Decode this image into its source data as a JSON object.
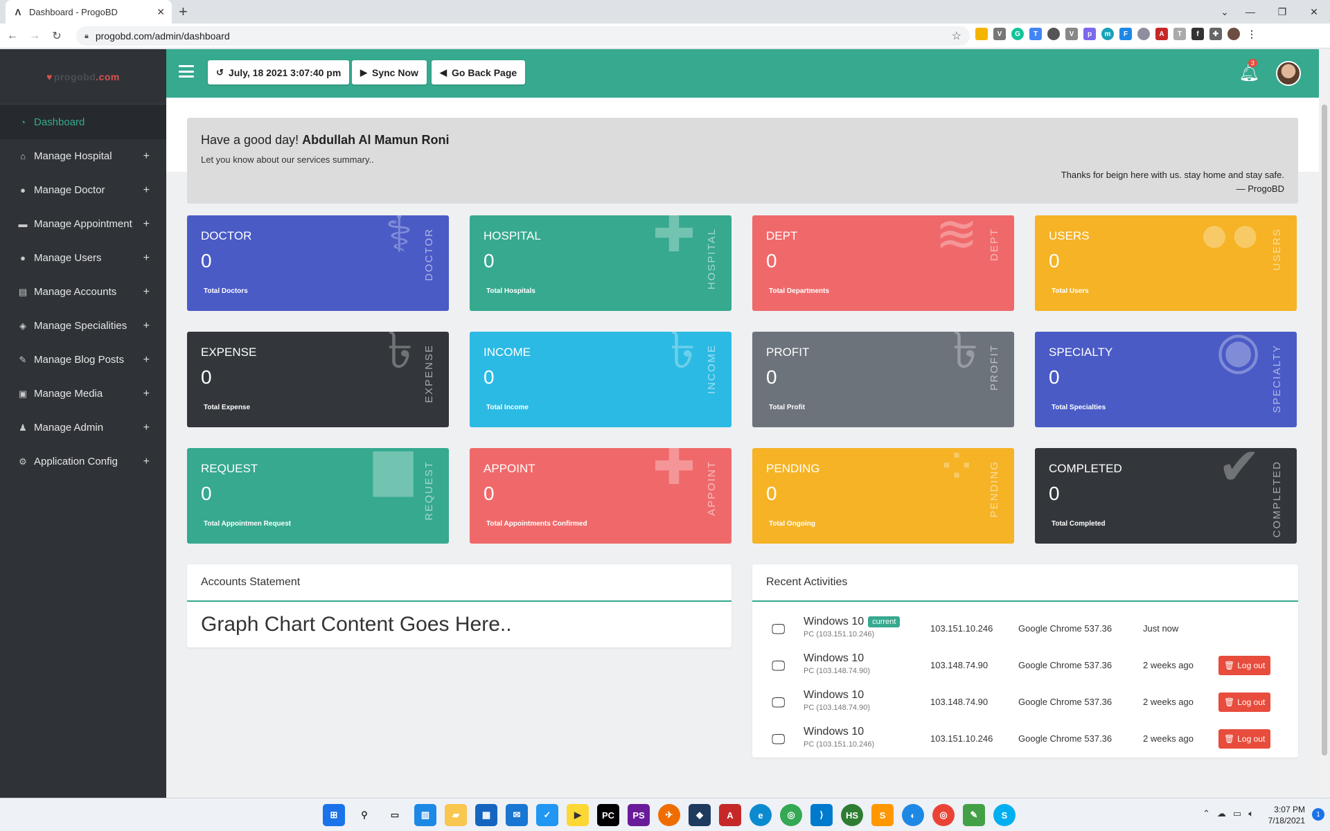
{
  "browser": {
    "tab_title": "Dashboard - ProgoBD",
    "tab_close": "✕",
    "new_tab": "+",
    "url": "progobd.com/admin/dashboard",
    "win_min": "—",
    "win_restore": "❐",
    "win_close": "✕"
  },
  "brand": {
    "logo_text": ".com"
  },
  "sidebar": {
    "items": [
      {
        "label": "Dashboard",
        "icon": "dashboard-icon",
        "active": true
      },
      {
        "label": "Manage Hospital",
        "icon": "hospital-icon"
      },
      {
        "label": "Manage Doctor",
        "icon": "doctor-icon"
      },
      {
        "label": "Manage Appointment",
        "icon": "appointment-icon"
      },
      {
        "label": "Manage Users",
        "icon": "user-icon"
      },
      {
        "label": "Manage Accounts",
        "icon": "accounts-icon"
      },
      {
        "label": "Manage Specialities",
        "icon": "layers-icon"
      },
      {
        "label": "Manage Blog Posts",
        "icon": "blog-icon"
      },
      {
        "label": "Manage Media",
        "icon": "media-icon"
      },
      {
        "label": "Manage Admin",
        "icon": "admin-icon"
      },
      {
        "label": "Application Config",
        "icon": "gears-icon"
      }
    ],
    "plus": "+"
  },
  "topbar": {
    "datetime": "July, 18 2021 3:07:40 pm",
    "sync_label": "Sync Now",
    "back_label": "Go Back Page",
    "notification_count": "3"
  },
  "welcome": {
    "greeting": "Have a good day!",
    "name": "Abdullah Al Mamun Roni",
    "subtitle": "Let you know about our services summary..",
    "quote": "Thanks for beign here with us. stay home and stay safe.",
    "cite": "— ProgoBD"
  },
  "cards": [
    {
      "title": "DOCTOR",
      "value": "0",
      "footer": "Total Doctors",
      "vlabel": "DOCTOR",
      "color": "#4a5bc6",
      "icon": "stethoscope-icon"
    },
    {
      "title": "HOSPITAL",
      "value": "0",
      "footer": "Total Hospitals",
      "vlabel": "HOSPITAL",
      "color": "#36a98f",
      "icon": "hospital-icon"
    },
    {
      "title": "DEPT",
      "value": "0",
      "footer": "Total Departments",
      "vlabel": "DEPT",
      "color": "#f0696a",
      "icon": "layers-icon"
    },
    {
      "title": "USERS",
      "value": "0",
      "footer": "Total Users",
      "vlabel": "USERS",
      "color": "#f5b325",
      "icon": "users-icon"
    },
    {
      "title": "EXPENSE",
      "value": "0",
      "footer": "Total Expense",
      "vlabel": "EXPENSE",
      "color": "#33373c",
      "icon": "taka-icon"
    },
    {
      "title": "INCOME",
      "value": "0",
      "footer": "Total Income",
      "vlabel": "INCOME",
      "color": "#2bbae3",
      "icon": "taka-icon"
    },
    {
      "title": "PROFIT",
      "value": "0",
      "footer": "Total Profit",
      "vlabel": "PROFIT",
      "color": "#6c737a",
      "icon": "taka-icon"
    },
    {
      "title": "SPECIALTY",
      "value": "0",
      "footer": "Total Specialties",
      "vlabel": "SPECIALTY",
      "color": "#4a5bc6",
      "icon": "rss-icon"
    },
    {
      "title": "REQUEST",
      "value": "0",
      "footer": "Total Appointmen Request",
      "vlabel": "REQUEST",
      "color": "#36a98f",
      "icon": "bed-icon"
    },
    {
      "title": "APPOINT",
      "value": "0",
      "footer": "Total Appointments Confirmed",
      "vlabel": "APPOINT",
      "color": "#f0696a",
      "icon": "medkit-icon"
    },
    {
      "title": "PENDING",
      "value": "0",
      "footer": "Total Ongoing",
      "vlabel": "PENDING",
      "color": "#f5b325",
      "icon": "spinner-icon"
    },
    {
      "title": "COMPLETED",
      "value": "0",
      "footer": "Total Completed",
      "vlabel": "COMPLETED",
      "color": "#33373c",
      "icon": "check-circle-icon"
    }
  ],
  "accounts": {
    "title": "Accounts Statement",
    "placeholder": "Graph Chart Content Goes Here.."
  },
  "activities": {
    "title": "Recent Activities",
    "current_label": "current",
    "logout_label": "Log out",
    "rows": [
      {
        "os": "Windows 10",
        "pc": "PC (103.151.10.246)",
        "ip": "103.151.10.246",
        "browser": "Google Chrome 537.36",
        "time": "Just now",
        "current": true
      },
      {
        "os": "Windows 10",
        "pc": "PC (103.148.74.90)",
        "ip": "103.148.74.90",
        "browser": "Google Chrome 537.36",
        "time": "2 weeks ago",
        "current": false
      },
      {
        "os": "Windows 10",
        "pc": "PC (103.148.74.90)",
        "ip": "103.148.74.90",
        "browser": "Google Chrome 537.36",
        "time": "2 weeks ago",
        "current": false
      },
      {
        "os": "Windows 10",
        "pc": "PC (103.151.10.246)",
        "ip": "103.151.10.246",
        "browser": "Google Chrome 537.36",
        "time": "2 weeks ago",
        "current": false
      }
    ]
  },
  "taskbar": {
    "time": "3:07 PM",
    "date": "7/18/2021",
    "notification_count": "1"
  },
  "colors": {
    "accent": "#36a98f",
    "sidebar": "#2f3338",
    "danger": "#e74c3c"
  }
}
